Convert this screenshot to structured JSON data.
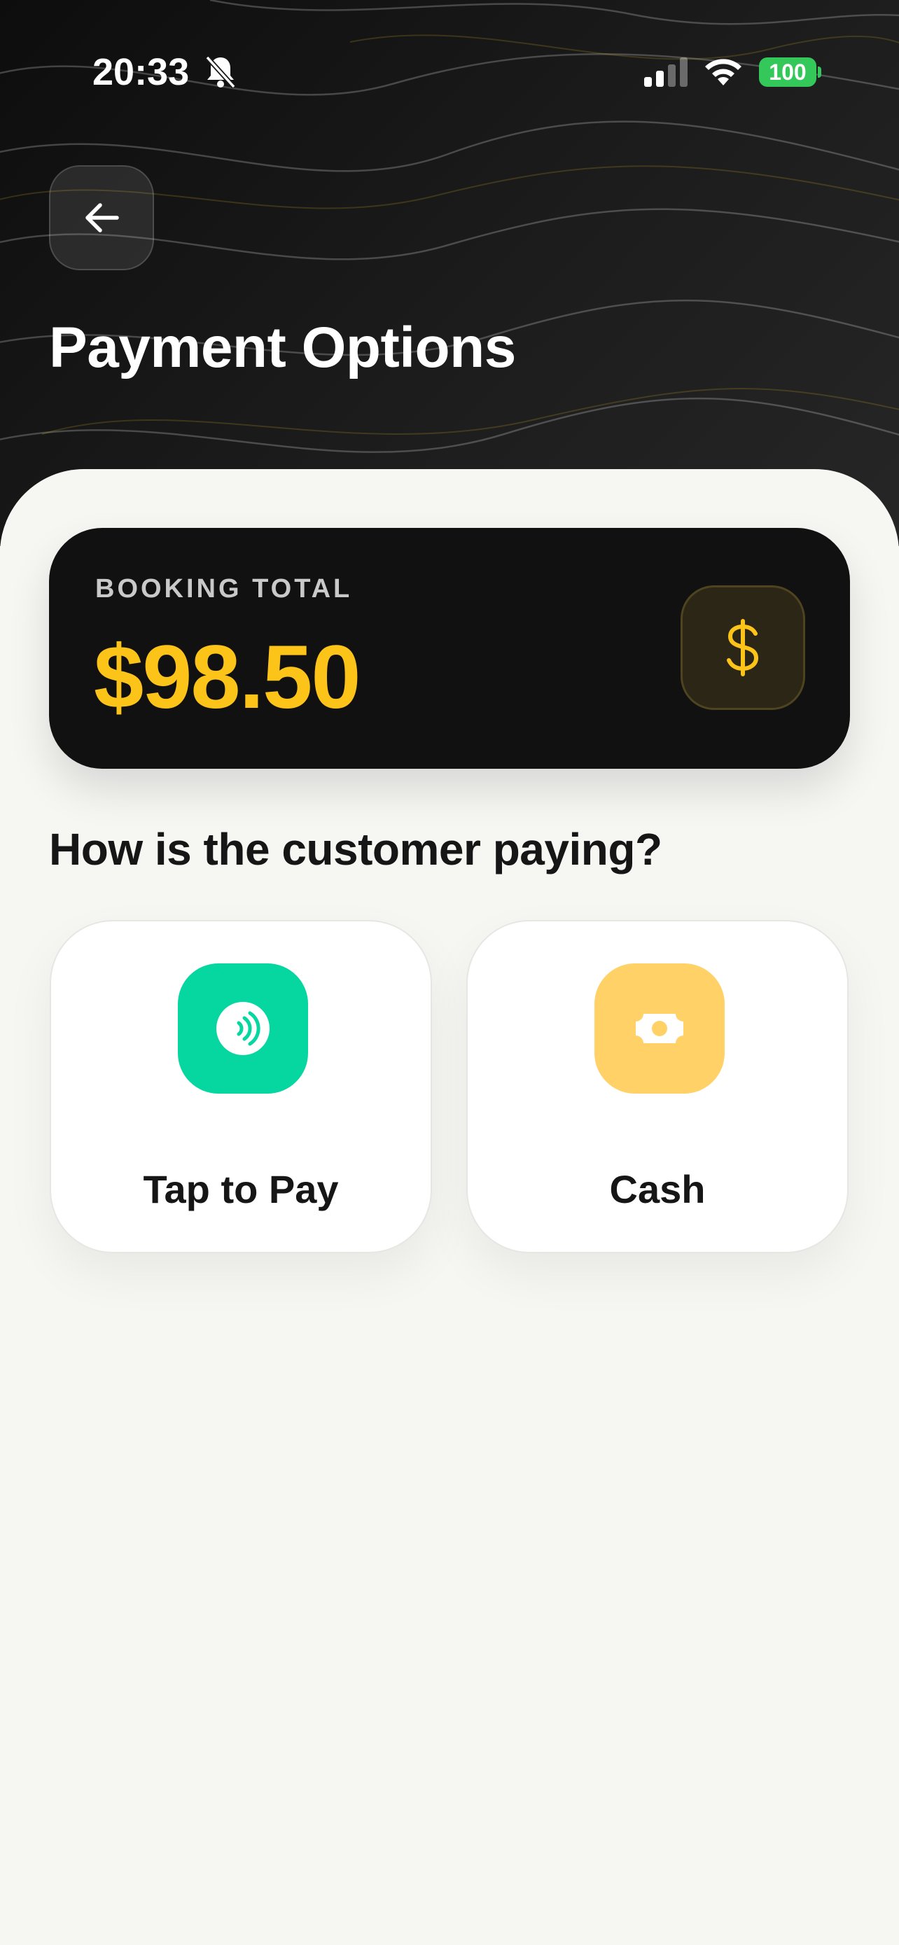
{
  "status_bar": {
    "time": "20:33",
    "battery": "100"
  },
  "header": {
    "title": "Payment Options"
  },
  "booking": {
    "label": "BOOKING TOTAL",
    "amount": "$98.50",
    "badge_symbol": "$"
  },
  "prompt": "How is the customer paying?",
  "options": [
    {
      "label": "Tap to Pay",
      "icon": "contactless-icon",
      "color": "#06d6a0"
    },
    {
      "label": "Cash",
      "icon": "cash-icon",
      "color": "#ffd166"
    }
  ],
  "colors": {
    "accent_gold": "#fcc419",
    "battery_green": "#34c759",
    "hero_dark": "#111111"
  }
}
